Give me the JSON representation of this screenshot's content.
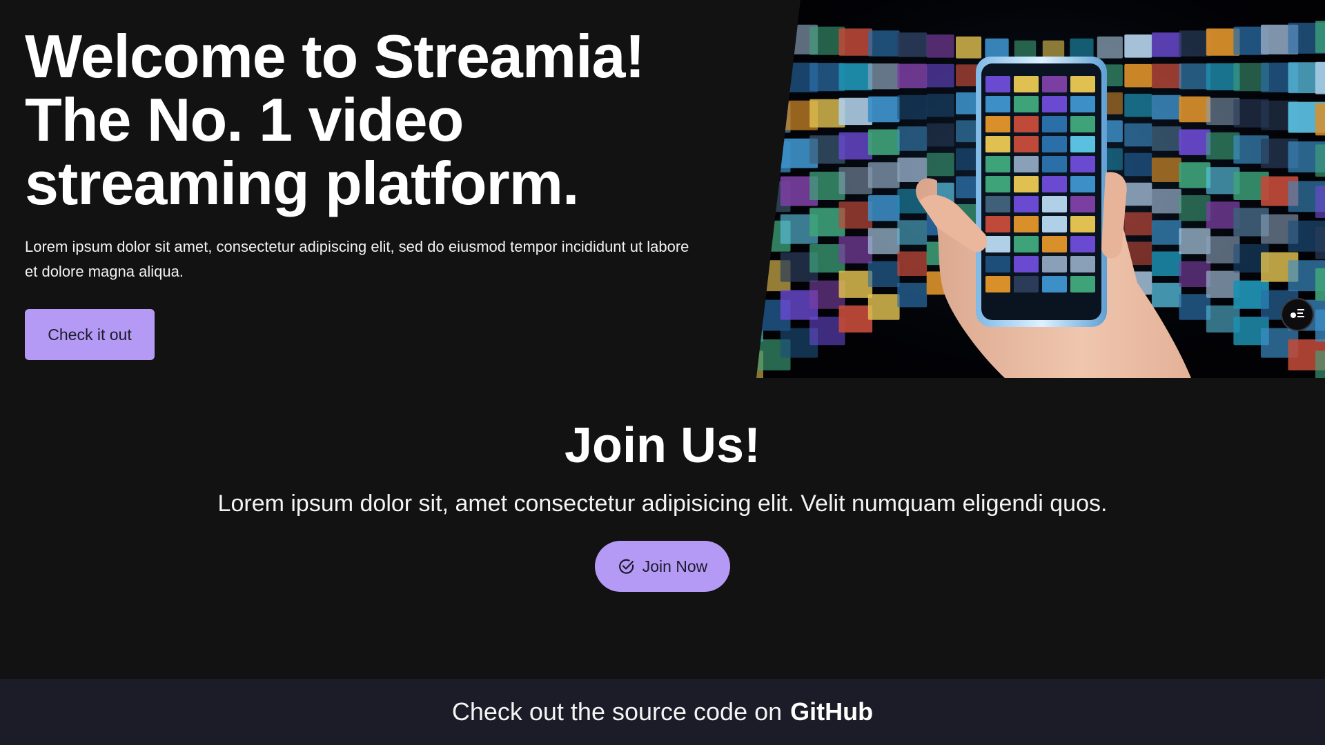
{
  "hero": {
    "title_lines": [
      "Welcome to Streamia!",
      "The No. 1 video",
      "streaming platform."
    ],
    "subtitle": "Lorem ipsum dolor sit amet, consectetur adipiscing elit, sed do eiusmod tempor incididunt ut labore et dolore magna aliqua.",
    "cta_label": "Check it out",
    "image_icon": "phone-video-wall-image",
    "floating_button_icon": "panel-menu-icon"
  },
  "join": {
    "title": "Join Us!",
    "subtitle": "Lorem ipsum dolor sit, amet consectetur adipisicing elit. Velit numquam eligendi quos.",
    "button_label": "Join Now",
    "button_icon": "check-circle-icon"
  },
  "footer": {
    "text": "Check out the source code on",
    "link_label": "GitHub"
  },
  "colors": {
    "background": "#121212",
    "accent": "#b49af5",
    "footer_bg": "#1c1c28",
    "text": "#ffffff"
  }
}
